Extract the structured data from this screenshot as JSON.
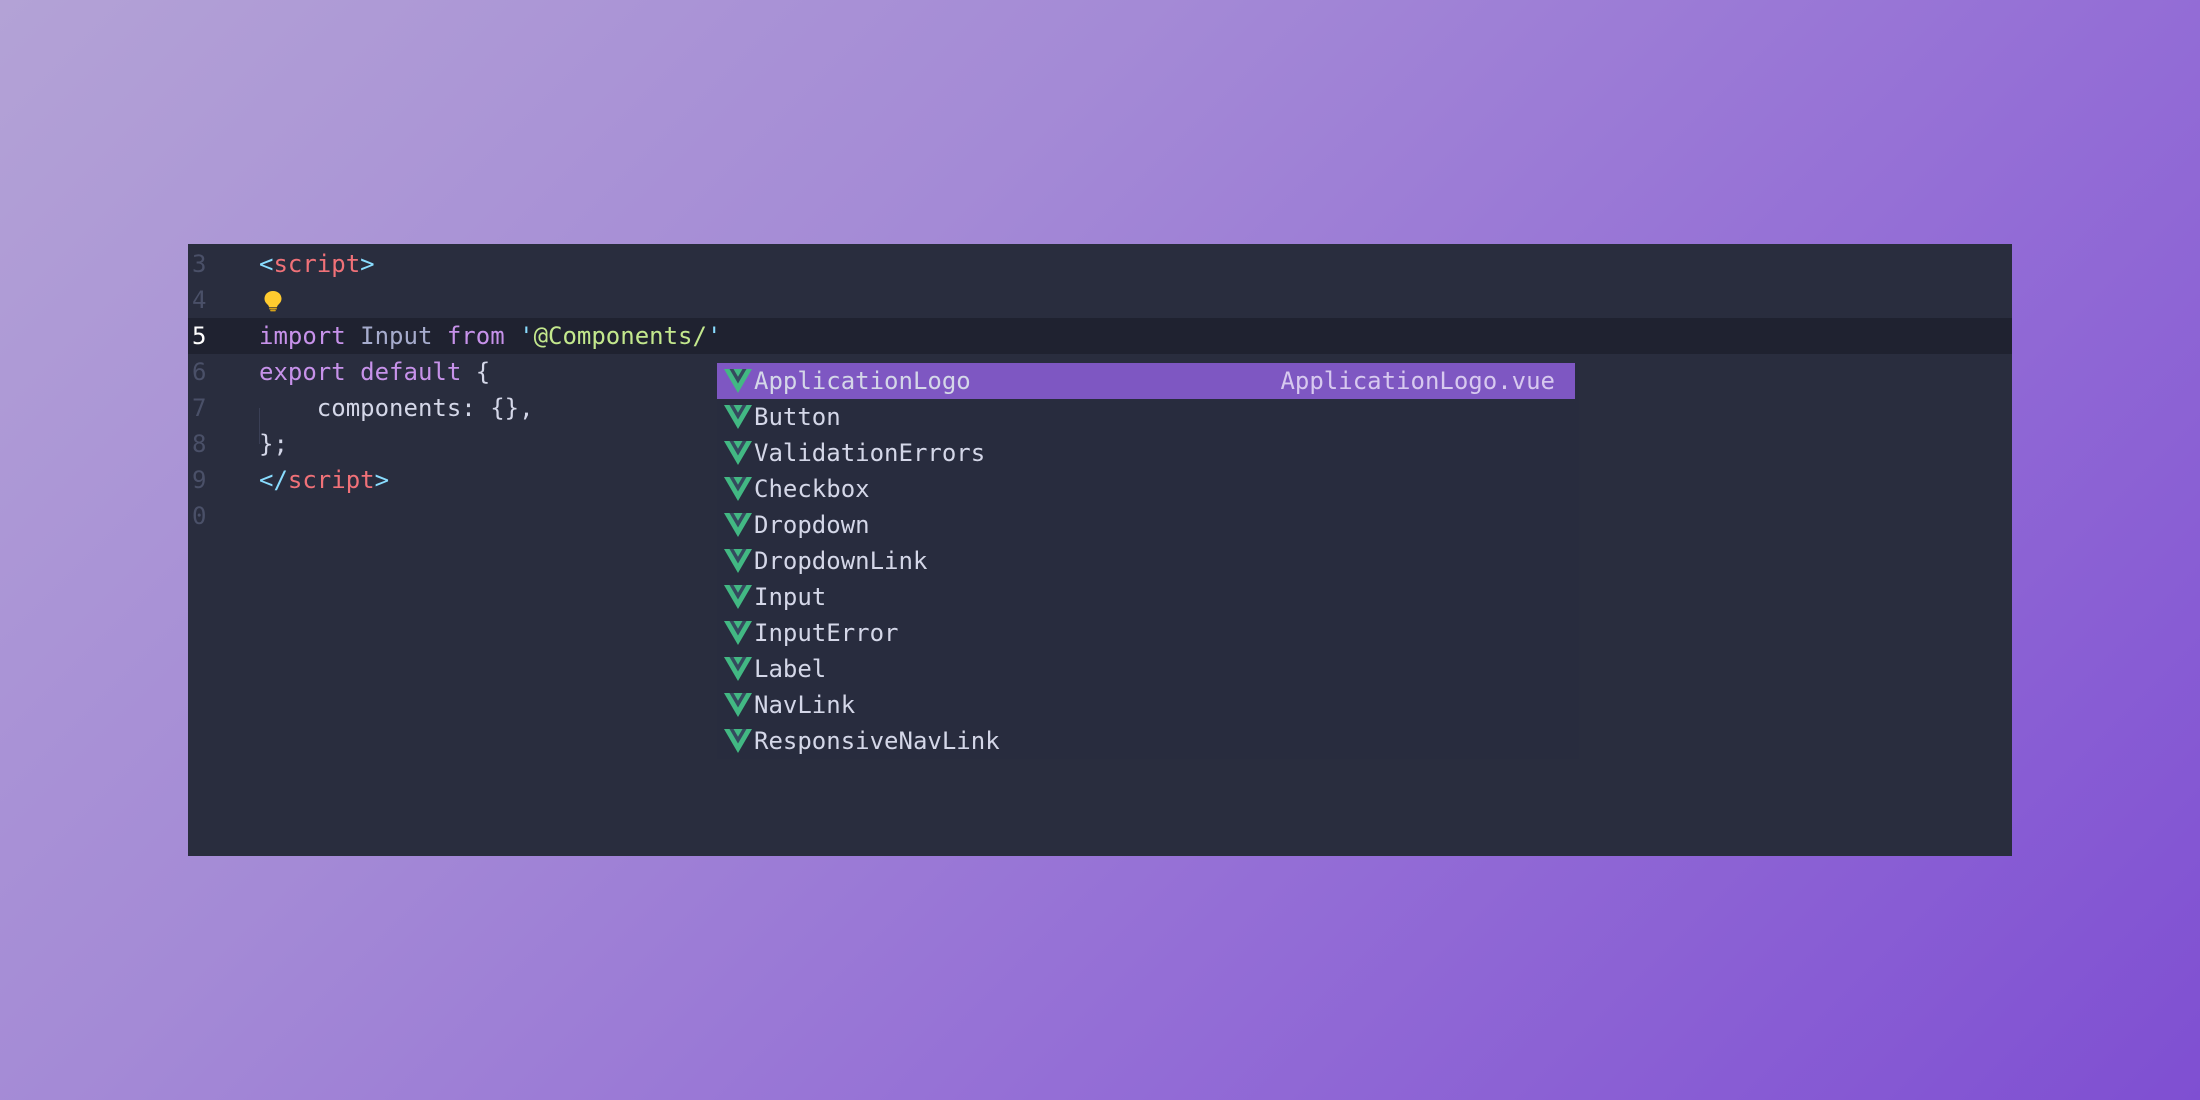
{
  "colors": {
    "background_gradient": [
      "#b3a2d6",
      "#7f4fd2"
    ],
    "editor_bg": "#292d3e",
    "current_line_bg": "#1f2230",
    "suggest_bg": "#282c3e",
    "selected_bg": "#7e57c2",
    "vue_icon": "#42b883"
  },
  "editor": {
    "lines": [
      {
        "number": "3",
        "tokens": [
          {
            "t": "<",
            "c": "punct"
          },
          {
            "t": "script",
            "c": "tag"
          },
          {
            "t": ">",
            "c": "punct"
          }
        ]
      },
      {
        "number": "4",
        "tokens": [],
        "icon": "lightbulb-icon"
      },
      {
        "number": "5",
        "current": true,
        "tokens": [
          {
            "t": "import",
            "c": "kw"
          },
          {
            "t": " Input ",
            "c": "id"
          },
          {
            "t": "from",
            "c": "kw"
          },
          {
            "t": " ",
            "c": "id"
          },
          {
            "t": "'",
            "c": "punct"
          },
          {
            "t": "@Components/",
            "c": "str"
          },
          {
            "t": "'",
            "c": "punct"
          }
        ]
      },
      {
        "number": "6",
        "tokens": [
          {
            "t": "export",
            "c": "kw"
          },
          {
            "t": " ",
            "c": "plain"
          },
          {
            "t": "default",
            "c": "kw"
          },
          {
            "t": " {",
            "c": "plain"
          }
        ]
      },
      {
        "number": "7",
        "tokens": [
          {
            "t": "    components: {},",
            "c": "plain"
          }
        ]
      },
      {
        "number": "8",
        "tokens": [
          {
            "t": "};",
            "c": "plain"
          }
        ]
      },
      {
        "number": "9",
        "tokens": [
          {
            "t": "</",
            "c": "punct"
          },
          {
            "t": "script",
            "c": "tag"
          },
          {
            "t": ">",
            "c": "punct"
          }
        ]
      },
      {
        "number": "0",
        "tokens": []
      }
    ]
  },
  "suggest": {
    "icon": "vue-icon",
    "items": [
      {
        "label": "ApplicationLogo",
        "detail": "ApplicationLogo.vue",
        "selected": true
      },
      {
        "label": "Button"
      },
      {
        "label": "ValidationErrors"
      },
      {
        "label": "Checkbox"
      },
      {
        "label": "Dropdown"
      },
      {
        "label": "DropdownLink"
      },
      {
        "label": "Input"
      },
      {
        "label": "InputError"
      },
      {
        "label": "Label"
      },
      {
        "label": "NavLink"
      },
      {
        "label": "ResponsiveNavLink"
      }
    ]
  }
}
